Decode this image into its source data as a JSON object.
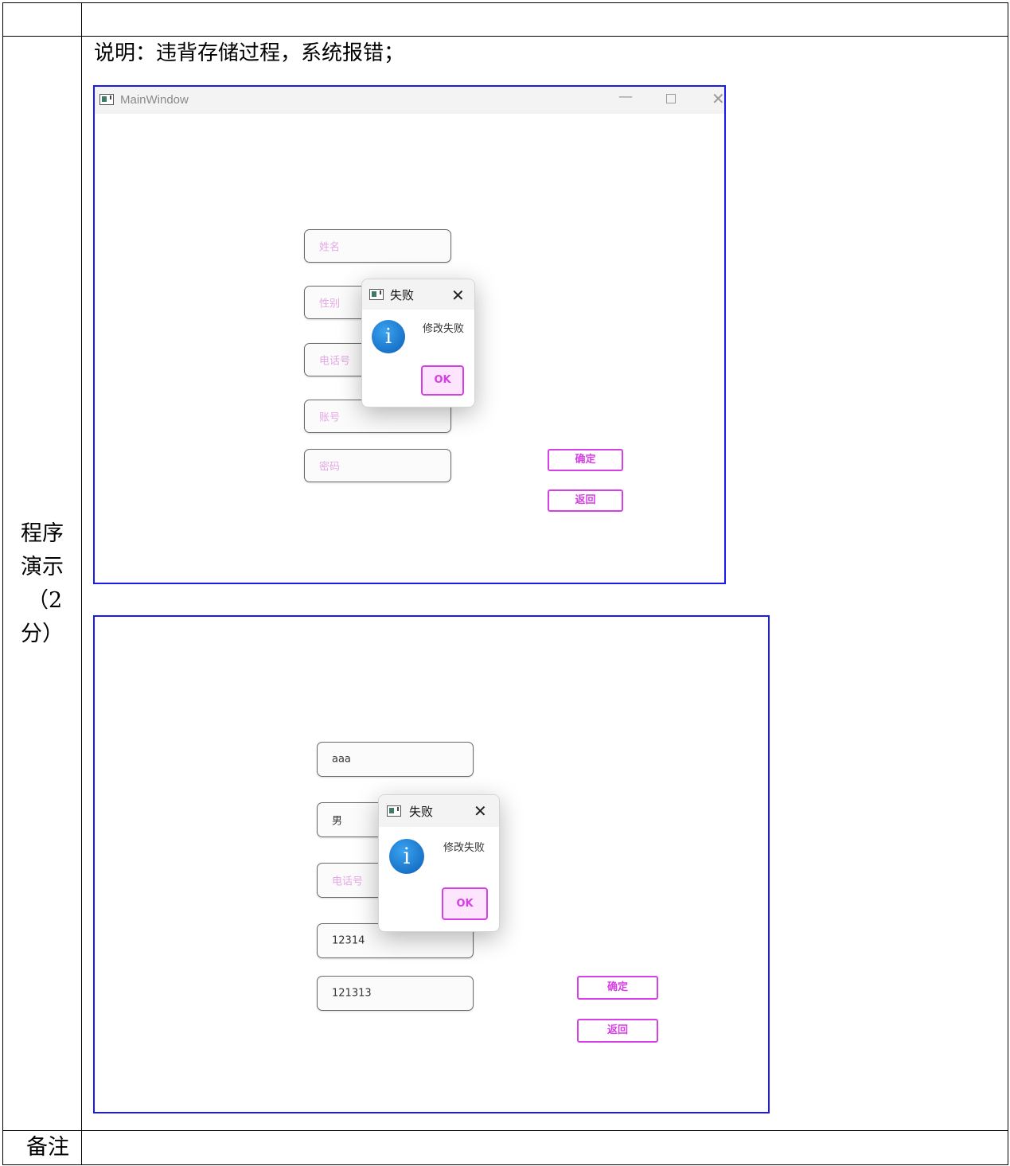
{
  "table": {
    "section_label": [
      "程序",
      "演示",
      "（2",
      "分）"
    ],
    "description": "说明：违背存储过程，系统报错；",
    "remarks_label": "备注"
  },
  "shot1": {
    "window_title": "MainWindow",
    "fields": [
      {
        "text": "姓名",
        "type": "placeholder"
      },
      {
        "text": "性别",
        "type": "placeholder"
      },
      {
        "text": "电话号",
        "type": "placeholder"
      },
      {
        "text": "账号",
        "type": "placeholder"
      },
      {
        "text": "密码",
        "type": "placeholder"
      }
    ],
    "confirm_label": "确定",
    "back_label": "返回",
    "dialog": {
      "title": "失败",
      "message": "修改失败",
      "ok_label": "OK"
    }
  },
  "shot2": {
    "fields": [
      {
        "text": "aaa",
        "type": "value"
      },
      {
        "text": "男",
        "type": "value"
      },
      {
        "text": "电话号",
        "type": "placeholder"
      },
      {
        "text": "12314",
        "type": "value"
      },
      {
        "text": "121313",
        "type": "value"
      }
    ],
    "confirm_label": "确定",
    "back_label": "返回",
    "dialog": {
      "title": "失败",
      "message": "修改失败",
      "ok_label": "OK"
    }
  },
  "colors": {
    "frame_border": "#1a1af0",
    "accent": "#d63ee6",
    "placeholder": "#e6a8e6",
    "info_icon": "#1a7fd6"
  }
}
